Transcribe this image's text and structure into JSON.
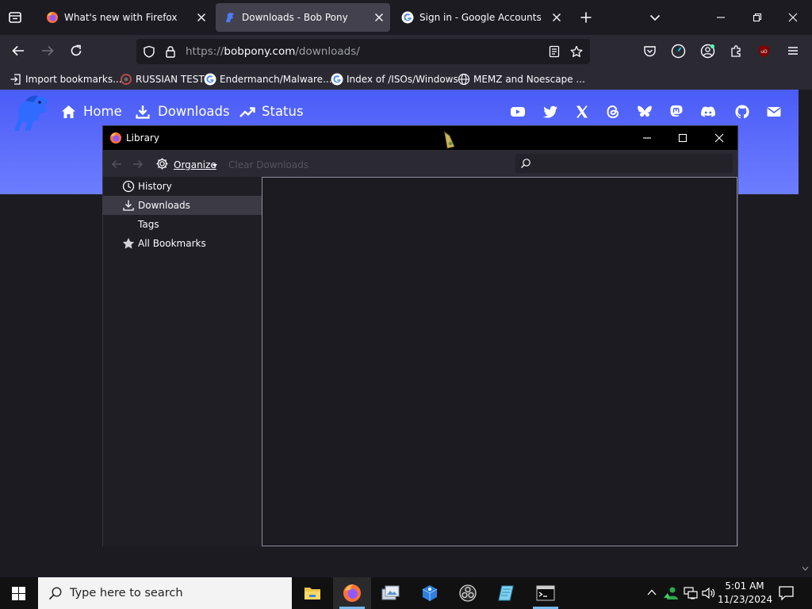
{
  "browser": {
    "tabs": [
      {
        "title": "What's new with Firefox",
        "active": false
      },
      {
        "title": "Downloads - Bob Pony",
        "active": true
      },
      {
        "title": "Sign in - Google Accounts",
        "active": false
      }
    ],
    "url": {
      "prefix": "https://",
      "host": "bobpony.com",
      "path": "/downloads/"
    },
    "bookmarks": [
      {
        "label": "Import bookmarks...",
        "icon": "import-icon"
      },
      {
        "label": "RUSSIAN TEST",
        "icon": "site-icon"
      },
      {
        "label": "Endermanch/Malware...",
        "icon": "google-icon"
      },
      {
        "label": "Index of /ISOs/Windows",
        "icon": "google-icon"
      },
      {
        "label": "MEMZ and Noescape ...",
        "icon": "globe-icon"
      }
    ]
  },
  "website": {
    "nav": [
      {
        "label": "Home",
        "icon": "home-icon"
      },
      {
        "label": "Downloads",
        "icon": "download-icon"
      },
      {
        "label": "Status",
        "icon": "trending-icon"
      }
    ],
    "social_icons": [
      "youtube-icon",
      "twitter-icon",
      "x-icon",
      "threads-icon",
      "bluesky-icon",
      "mastodon-icon",
      "discord-icon",
      "github-icon",
      "mail-icon"
    ],
    "hero_color": "#4a5cf7"
  },
  "library": {
    "title": "Library",
    "organize_label": "Organize",
    "clear_label": "Clear Downloads",
    "sidebar": [
      {
        "label": "History",
        "icon": "clock-icon",
        "selected": false
      },
      {
        "label": "Downloads",
        "icon": "download-icon",
        "selected": true
      },
      {
        "label": "Tags",
        "icon": "",
        "selected": false
      },
      {
        "label": "All Bookmarks",
        "icon": "star-icon",
        "selected": false
      }
    ]
  },
  "taskbar": {
    "search_placeholder": "Type here to search",
    "time": "5:01 AM",
    "date": "11/23/2024",
    "apps": [
      "file-explorer-icon",
      "firefox-icon",
      "photos-icon",
      "settings-cube-icon",
      "obs-icon",
      "notepad-icon",
      "terminal-icon"
    ]
  }
}
